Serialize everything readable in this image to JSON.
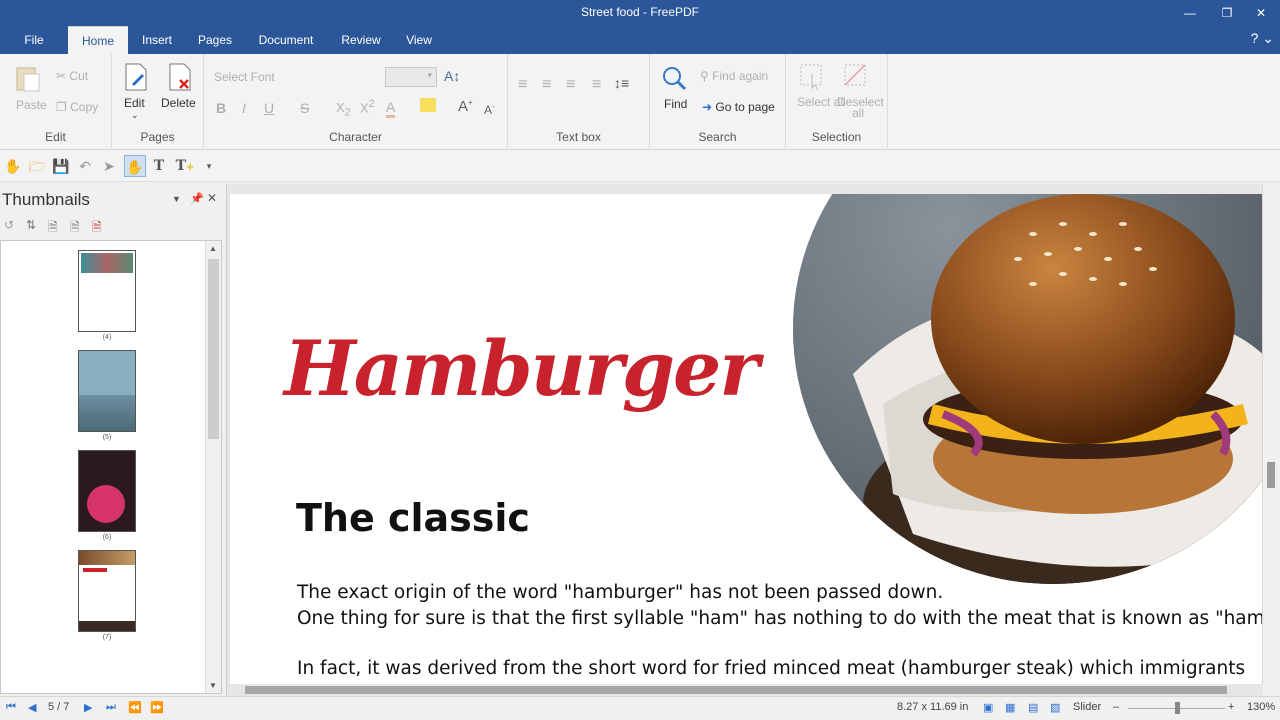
{
  "window": {
    "title": "Street food - FreePDF"
  },
  "tabs": [
    {
      "label": "File"
    },
    {
      "label": "Home"
    },
    {
      "label": "Insert"
    },
    {
      "label": "Pages"
    },
    {
      "label": "Document"
    },
    {
      "label": "Review"
    },
    {
      "label": "View"
    }
  ],
  "ribbon": {
    "edit": {
      "label": "Edit",
      "paste": "Paste",
      "cut": "Cut",
      "copy": "Copy"
    },
    "pages": {
      "label": "Pages",
      "edit": "Edit",
      "delete": "Delete"
    },
    "character": {
      "label": "Character",
      "font_placeholder": "Select Font"
    },
    "textbox": {
      "label": "Text box"
    },
    "search": {
      "label": "Search",
      "find": "Find",
      "find_again": "Find again",
      "go_to_page": "Go to page"
    },
    "selection": {
      "label": "Selection",
      "select_all": "Select all",
      "deselect_all": "Deselect all"
    }
  },
  "thumbnails": {
    "title": "Thumbnails",
    "pages": [
      {
        "label": "(4)"
      },
      {
        "label": "(5)"
      },
      {
        "label": "(6)"
      },
      {
        "label": "(7)"
      }
    ]
  },
  "document": {
    "logo_text": "Hamburger",
    "heading": "The classic",
    "para1": "The exact origin of the word \"hamburger\" has not been passed down.",
    "para2": "One thing for sure is that the first syllable \"ham\" has nothing to do with the meat that is known as \"ham\".",
    "para3": "In fact, it was derived from the short word for fried minced meat (hamburger steak) which immigrants"
  },
  "statusbar": {
    "page_indicator": "5 / 7",
    "page_size": "8.27 x 11.69 in",
    "slider_label": "Slider",
    "zoom": "130%",
    "zoom_level": 0.5
  },
  "colors": {
    "titlebar": "#2b579a",
    "accent_red": "#c8232c"
  }
}
